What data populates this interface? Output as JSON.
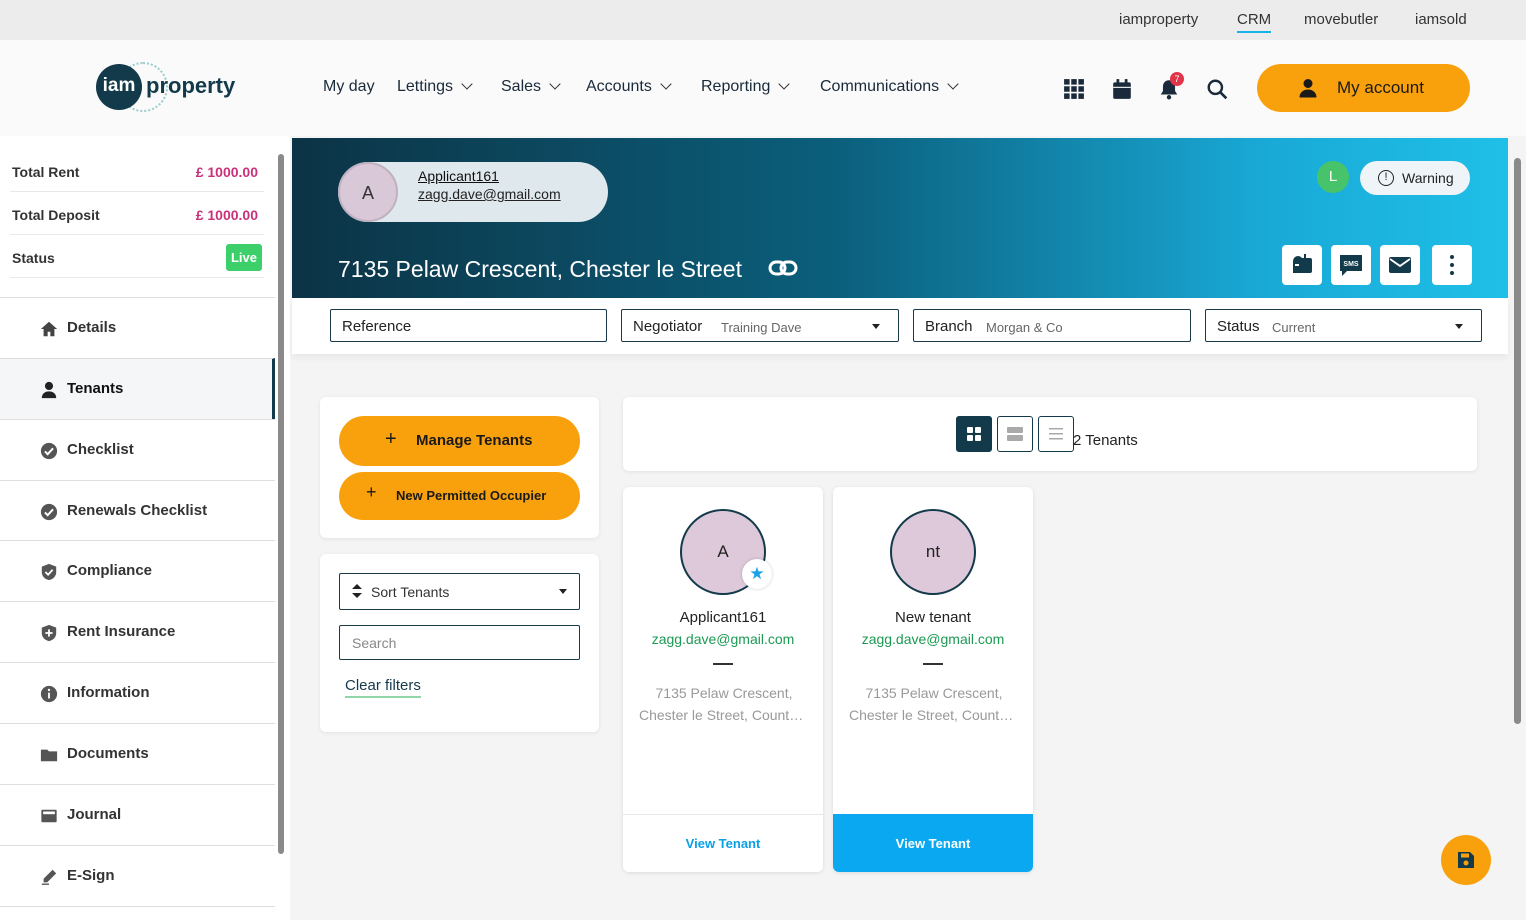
{
  "top_links": [
    "iamproperty",
    "CRM",
    "movebutler",
    "iamsold"
  ],
  "logo": {
    "mark": "iam",
    "text": "property"
  },
  "nav": [
    {
      "label": "My day"
    },
    {
      "label": "Lettings"
    },
    {
      "label": "Sales"
    },
    {
      "label": "Accounts"
    },
    {
      "label": "Reporting"
    },
    {
      "label": "Communications"
    }
  ],
  "notifications_count": "7",
  "my_account_label": "My account",
  "summary": {
    "total_rent_label": "Total Rent",
    "total_rent": "£ 1000.00",
    "total_deposit_label": "Total Deposit",
    "total_deposit": "£ 1000.00",
    "status_label": "Status",
    "status": "Live"
  },
  "sidebar": [
    {
      "label": "Details",
      "icon": "home-icon"
    },
    {
      "label": "Tenants",
      "icon": "person-icon"
    },
    {
      "label": "Checklist",
      "icon": "check-circle-icon"
    },
    {
      "label": "Renewals Checklist",
      "icon": "check-circle-icon"
    },
    {
      "label": "Compliance",
      "icon": "shield-check-icon"
    },
    {
      "label": "Rent Insurance",
      "icon": "shield-plus-icon"
    },
    {
      "label": "Information",
      "icon": "info-icon"
    },
    {
      "label": "Documents",
      "icon": "folder-icon"
    },
    {
      "label": "Journal",
      "icon": "journal-icon"
    },
    {
      "label": "E-Sign",
      "icon": "pen-icon"
    }
  ],
  "property": {
    "applicant_initial": "A",
    "applicant_name": "Applicant161",
    "applicant_email": "zagg.dave@gmail.com",
    "address": "7135 Pelaw Crescent, Chester le Street",
    "user_badge": "L",
    "warning_label": "Warning",
    "sms_label": "SMS"
  },
  "fields": {
    "reference_label": "Reference",
    "negotiator_label": "Negotiator",
    "negotiator_value": "Training Dave",
    "branch_label": "Branch",
    "branch_value": "Morgan & Co",
    "status_label": "Status",
    "status_value": "Current"
  },
  "actions": {
    "manage_tenants": "Manage Tenants",
    "new_permitted_occupier": "New Permitted Occupier"
  },
  "filters": {
    "sort_label": "Sort Tenants",
    "search_placeholder": "Search",
    "clear_label": "Clear filters"
  },
  "tenants_count": "2 Tenants",
  "tenants": [
    {
      "initials": "A",
      "name": "Applicant161",
      "email": "zagg.dave@gmail.com",
      "address_line1": "7135 Pelaw Crescent,",
      "address_line2": "Chester le Street, County Durham",
      "lead": true,
      "button": "View Tenant"
    },
    {
      "initials": "nt",
      "name": "New tenant",
      "email": "zagg.dave@gmail.com",
      "address_line1": "7135 Pelaw Crescent,",
      "address_line2": "Chester le Street, County Durham",
      "lead": false,
      "button": "View Tenant"
    }
  ],
  "colors": {
    "accent": "#f9a10d",
    "primary_dark": "#133a4a",
    "link_blue": "#0aa8f0",
    "email_green": "#1c9a52",
    "amount_pink": "#c8327a",
    "live_green": "#3ccf6a"
  }
}
